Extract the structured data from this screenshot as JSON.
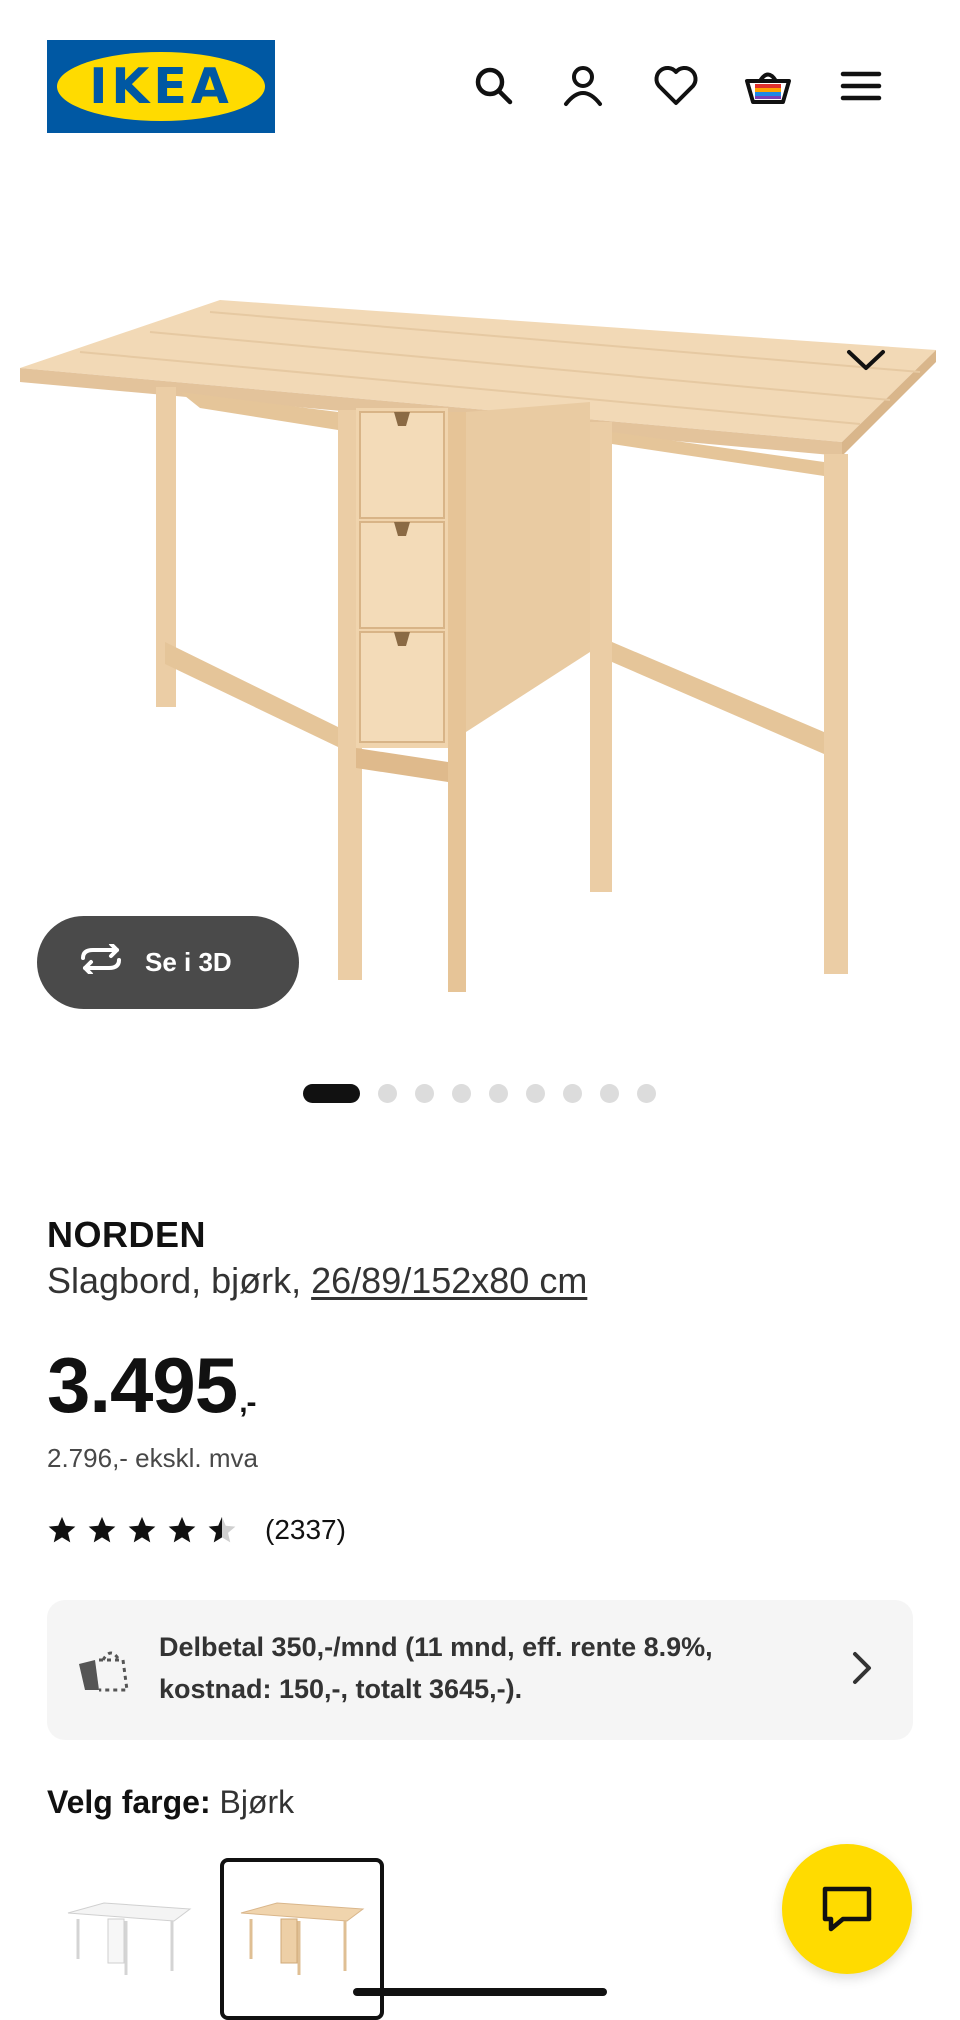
{
  "header": {
    "logo_text": "IKEA",
    "icons": [
      "search-icon",
      "account-icon",
      "heart-icon",
      "cart-icon",
      "menu-icon"
    ]
  },
  "gallery": {
    "btn_3d_label": "Se i 3D",
    "image_count": 9,
    "active_index": 0
  },
  "product": {
    "name": "NORDEN",
    "desc_prefix": "Slagbord, bjørk, ",
    "dimensions": "26/89/152x80 cm",
    "price_main": "3.495",
    "price_suffix": ",-",
    "price_ex_vat": "2.796,- ekskl. mva",
    "rating": 4.5,
    "rating_count": "(2337)"
  },
  "finance": {
    "text": "Delbetal 350,-/mnd (11 mnd, eff. rente 8.9%, kostnad: 150,-, totalt 3645,-)."
  },
  "color": {
    "label": "Velg farge:",
    "value": "Bjørk",
    "options": [
      "white",
      "birch"
    ],
    "selected": "birch"
  },
  "colors": {
    "ikea_blue": "#0058a3",
    "ikea_yellow": "#ffdb00",
    "button_dark": "#4a4a4a",
    "birch": "#efd4ad"
  }
}
